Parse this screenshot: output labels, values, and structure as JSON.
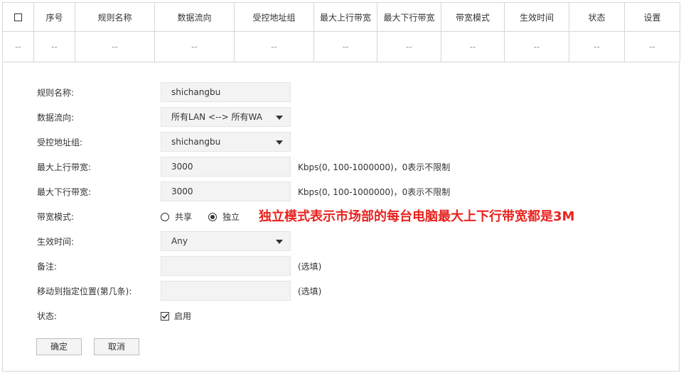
{
  "table": {
    "headers": [
      "序号",
      "规则名称",
      "数据流向",
      "受控地址组",
      "最大上行带宽",
      "最大下行带宽",
      "带宽模式",
      "生效时间",
      "状态",
      "设置"
    ],
    "empty_row": [
      "--",
      "--",
      "--",
      "--",
      "--",
      "--",
      "--",
      "--",
      "--",
      "--",
      "--"
    ]
  },
  "form": {
    "rule_name": {
      "label": "规则名称:",
      "value": "shichangbu"
    },
    "direction": {
      "label": "数据流向:",
      "value": "所有LAN <--> 所有WA"
    },
    "address_group": {
      "label": "受控地址组:",
      "value": "shichangbu"
    },
    "max_up": {
      "label": "最大上行带宽:",
      "value": "3000",
      "hint": "Kbps(0, 100-1000000)，0表示不限制"
    },
    "max_down": {
      "label": "最大下行带宽:",
      "value": "3000",
      "hint": "Kbps(0, 100-1000000)，0表示不限制"
    },
    "bandwidth_mode": {
      "label": "带宽模式:",
      "option_shared": "共享",
      "option_independent": "独立",
      "selected": "独立"
    },
    "effective_time": {
      "label": "生效时间:",
      "value": "Any"
    },
    "note": {
      "label": "备注:",
      "value": "",
      "hint": "(选填)"
    },
    "position": {
      "label": "移动到指定位置(第几条):",
      "value": "",
      "hint": "(选填)"
    },
    "status": {
      "label": "状态:",
      "checkbox_label": "启用",
      "checked": true
    }
  },
  "buttons": {
    "ok": "确定",
    "cancel": "取消"
  },
  "annotation": {
    "text": "独立模式表示市场部的每台电脑最大上下行带宽都是3M",
    "color": "#e8231f"
  }
}
